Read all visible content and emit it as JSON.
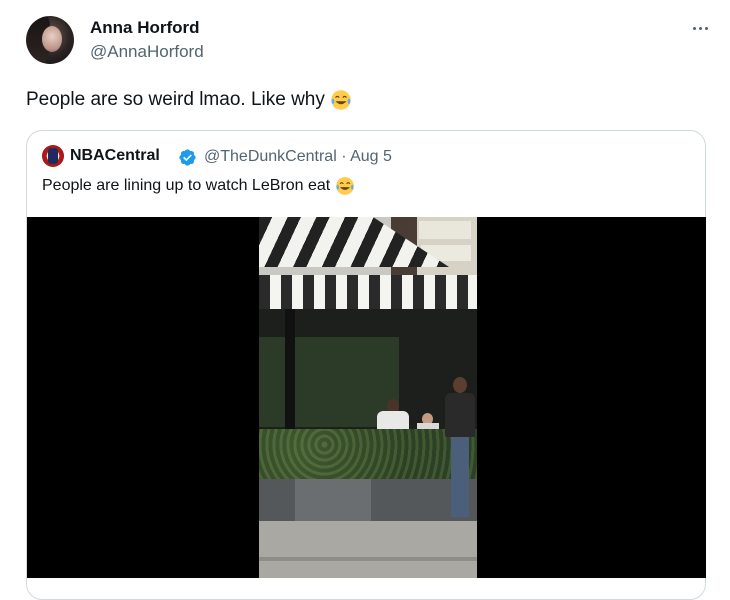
{
  "tweet": {
    "author_name": "Anna Horford",
    "author_handle": "@AnnaHorford",
    "text": "People are so weird lmao. Like why",
    "emoji": "face-with-tears-of-joy"
  },
  "quoted_tweet": {
    "author_name": "NBACentral",
    "verified": true,
    "author_handle": "@TheDunkCentral",
    "separator": "·",
    "date": "Aug 5",
    "text": "People are lining up to watch LeBron eat",
    "emoji": "face-with-tears-of-joy"
  },
  "media": {
    "type": "video",
    "description_hidden": true
  },
  "colors": {
    "text_primary": "#0f1419",
    "text_secondary": "#536471",
    "border": "#cfd9de",
    "verified_blue": "#1d9bf0"
  }
}
